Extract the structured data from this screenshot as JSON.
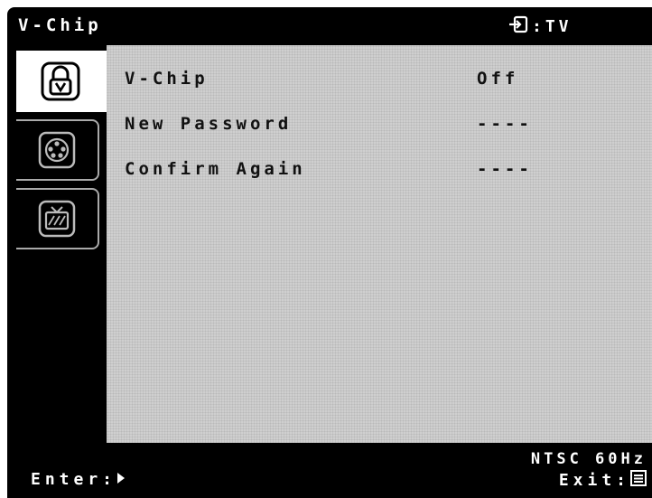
{
  "header": {
    "title": "V-Chip",
    "source_label": ":TV",
    "source_icon": "input-source-icon"
  },
  "sidebar": {
    "tabs": [
      {
        "icon": "padlock-v-icon",
        "active": true
      },
      {
        "icon": "film-reel-icon",
        "active": false
      },
      {
        "icon": "tv-rating-icon",
        "active": false
      }
    ]
  },
  "menu": {
    "rows": [
      {
        "label": "V-Chip",
        "value": "Off"
      },
      {
        "label": "New Password",
        "value": "----"
      },
      {
        "label": "Confirm Again",
        "value": "----"
      }
    ]
  },
  "footer": {
    "signal_status": "NTSC 60Hz",
    "enter_label": "Enter:",
    "exit_label": "Exit:",
    "enter_icon": "play-arrow-icon",
    "exit_icon": "menu-icon"
  }
}
